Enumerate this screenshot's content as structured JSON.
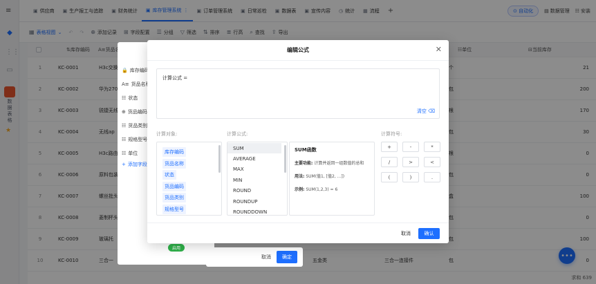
{
  "tabs": [
    {
      "label": "供应商",
      "icon": "doc-icon",
      "active": false
    },
    {
      "label": "生产报工与追踪",
      "icon": "doc-icon",
      "active": false
    },
    {
      "label": "财务统计",
      "icon": "doc-icon",
      "active": false
    },
    {
      "label": "库存管理系统",
      "icon": "doc-icon",
      "active": true
    },
    {
      "label": "订单管理系统",
      "icon": "doc-icon",
      "active": false
    },
    {
      "label": "日常巡检",
      "icon": "doc-icon",
      "active": false
    },
    {
      "label": "数据表",
      "icon": "doc-icon",
      "active": false
    },
    {
      "label": "宣传内容",
      "icon": "doc-icon",
      "active": false
    },
    {
      "label": "统计",
      "icon": "clock-icon",
      "active": false
    },
    {
      "label": "流程",
      "icon": "grid-icon",
      "active": false
    }
  ],
  "topbar_right": {
    "auto_label": "自动化",
    "data_manage": "数据管理",
    "install": "安装"
  },
  "toolbar": {
    "view": "表格视图",
    "add_record": "添加记录",
    "field_config": "字段配置",
    "group": "分组",
    "filter": "筛选",
    "sort": "排序",
    "row_height": "行高",
    "search": "查找",
    "export": "导出"
  },
  "table": {
    "headers": {
      "code": "库存编码",
      "name": "货品名",
      "unit": "单位",
      "stock": "当前库存"
    },
    "rows": [
      {
        "idx": "1",
        "code": "KC-0001",
        "name": "H3c交换机",
        "unit": "个",
        "stock": "21"
      },
      {
        "idx": "2",
        "code": "KC-0002",
        "name": "华为2700S",
        "unit": "包",
        "stock": "200"
      },
      {
        "idx": "3",
        "code": "KC-0003",
        "name": "锐捷无线ap",
        "unit": "根",
        "stock": "170"
      },
      {
        "idx": "4",
        "code": "KC-0004",
        "name": "无线ap",
        "unit": "包",
        "stock": "30"
      },
      {
        "idx": "5",
        "code": "KC-0005",
        "name": "H3c路由器",
        "unit": "根",
        "stock": "0"
      },
      {
        "idx": "6",
        "code": "KC-0006",
        "name": "原料包装",
        "unit": "包",
        "stock": "0"
      },
      {
        "idx": "7",
        "code": "KC-0007",
        "name": "螺丝批头",
        "unit": "盒",
        "stock": "100"
      },
      {
        "idx": "8",
        "code": "KC-0008",
        "name": "菱制杯头螺丝",
        "unit": "包",
        "stock": "0"
      },
      {
        "idx": "9",
        "code": "KC-0009",
        "name": "玻璃托",
        "unit": "包",
        "stock": "100"
      },
      {
        "idx": "10",
        "code": "KC-0010",
        "name": "三合一",
        "extra1": "五金类",
        "extra2": "三合一连接件",
        "unit": "包",
        "stock": "0"
      }
    ],
    "footer": "求和 639"
  },
  "rail": {
    "app_text": "数据表格"
  },
  "popover": {
    "items": [
      "库存编码",
      "货品名称",
      "状态",
      "货品编码",
      "货品类别",
      "规格型号",
      "单位"
    ],
    "add_label": "添加字段",
    "cancel": "取消",
    "ok": "确定"
  },
  "modal": {
    "title": "编辑公式",
    "formula_label": "计算公式 =",
    "clear": "清空",
    "section_objects": "计算对象:",
    "section_formulas": "计算公式:",
    "section_operators": "计算符号:",
    "objects": [
      "库存编码",
      "货品名称",
      "状态",
      "货品编码",
      "货品类别",
      "规格型号"
    ],
    "functions": [
      "SUM",
      "AVERAGE",
      "MAX",
      "MIN",
      "ROUND",
      "ROUNDUP",
      "ROUNDDOWN"
    ],
    "selected_function": "SUM",
    "desc": {
      "title": "SUM函数",
      "main_label": "主要功能:",
      "main_text": "计算并返回一组数值的总和",
      "usage_label": "用法:",
      "usage_text": "SUM(值1, [值2, ...])",
      "example_label": "示例:",
      "example_text": "SUM(1,2,3) = 6"
    },
    "operators": [
      "+",
      "-",
      "*",
      "/",
      ">",
      "<",
      "(",
      ")",
      "."
    ],
    "cancel": "取消",
    "confirm": "确认"
  }
}
